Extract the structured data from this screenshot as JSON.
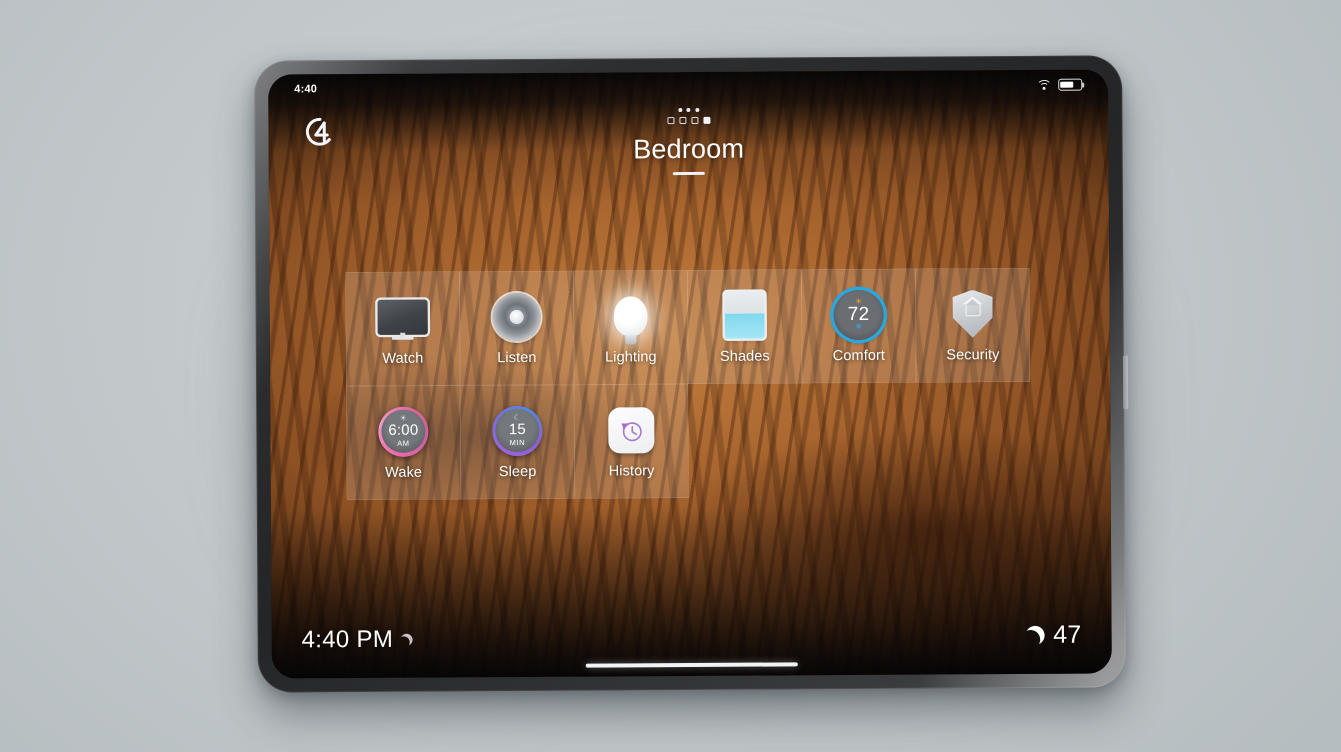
{
  "status_bar": {
    "time": "4:40",
    "wifi_icon": "wifi-icon",
    "battery_icon": "battery-icon"
  },
  "header": {
    "logo": "control4-logo",
    "room_title": "Bedroom",
    "page_indicator": {
      "total": 4,
      "active_index": 3
    },
    "menu_dots": "more-dots-icon"
  },
  "grid": {
    "row1": [
      {
        "label": "Watch",
        "icon": "television-icon"
      },
      {
        "label": "Listen",
        "icon": "speaker-icon"
      },
      {
        "label": "Lighting",
        "icon": "lightbulb-icon"
      },
      {
        "label": "Shades",
        "icon": "window-shade-icon"
      },
      {
        "label": "Comfort",
        "icon": "thermostat-icon",
        "temperature": "72",
        "heat_icon": "sun-icon",
        "cool_icon": "snowflake-icon"
      },
      {
        "label": "Security",
        "icon": "shield-home-icon"
      }
    ],
    "row2": [
      {
        "label": "Wake",
        "icon": "sun-icon",
        "value": "6:00",
        "unit": "AM"
      },
      {
        "label": "Sleep",
        "icon": "moon-icon",
        "value": "15",
        "unit": "MIN"
      },
      {
        "label": "History",
        "icon": "clock-history-icon"
      }
    ]
  },
  "bottom_bar": {
    "clock": "4:40 PM",
    "clock_icon": "moon-icon",
    "weather_icon": "moon-icon",
    "temperature": "47"
  },
  "colors": {
    "accent_blue": "#29a8e0",
    "wake_pink": "#f06ab0",
    "sleep_purple": "#7b6ee0",
    "shade_cyan": "#7fd8ee",
    "sun_orange": "#f0a32a"
  }
}
